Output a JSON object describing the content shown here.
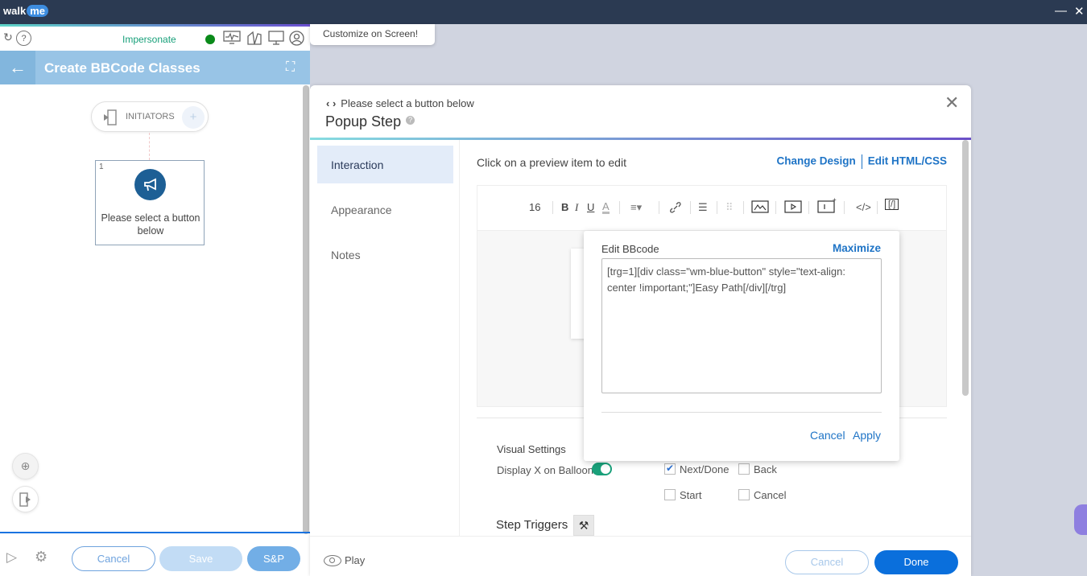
{
  "titlebar": {
    "logo_a": "walk",
    "logo_b": "me",
    "minimize": "—",
    "close": "✕"
  },
  "left": {
    "impersonate": "Impersonate",
    "status_color": "#0a8a1a",
    "header_title": "Create BBCode Classes",
    "initiators": "INITIATORS",
    "step": {
      "number": "1",
      "title": "Please select a button below"
    },
    "footer": {
      "cancel": "Cancel",
      "save": "Save",
      "sp": "S&P"
    }
  },
  "customize": "Customize on Screen!",
  "dialog": {
    "breadcrumb": "Please select a button below",
    "title": "Popup Step",
    "help": "?",
    "nav": [
      {
        "label": "Interaction",
        "active": true
      },
      {
        "label": "Appearance"
      },
      {
        "label": "Notes"
      }
    ],
    "hint": "Click on a preview item to edit",
    "change_design": "Change Design",
    "edit_html": "Edit HTML/CSS",
    "toolbar": {
      "font_size": "16",
      "bold": "B",
      "italic": "I",
      "underline": "U",
      "color": "A",
      "align": "≡▾",
      "link": "🔗",
      "list": "☰",
      "code": "</>",
      "bbcode": "[/]"
    },
    "visual_settings": "Visual Settings",
    "display_x": "Display X on Balloon",
    "display_x_on": true,
    "buttons": [
      {
        "label": "Next/Done",
        "checked": true
      },
      {
        "label": "Back",
        "checked": false
      },
      {
        "label": "Start",
        "checked": false
      },
      {
        "label": "Cancel",
        "checked": false
      }
    ],
    "step_triggers": "Step Triggers",
    "footer": {
      "play": "Play",
      "cancel": "Cancel",
      "done": "Done"
    }
  },
  "bbcode": {
    "title": "Edit BBcode",
    "maximize": "Maximize",
    "value": "[trg=1][div class=\"wm-blue-button\" style=\"text-align: center !important;\"]Easy Path[/div][/trg]",
    "cancel": "Cancel",
    "apply": "Apply"
  }
}
